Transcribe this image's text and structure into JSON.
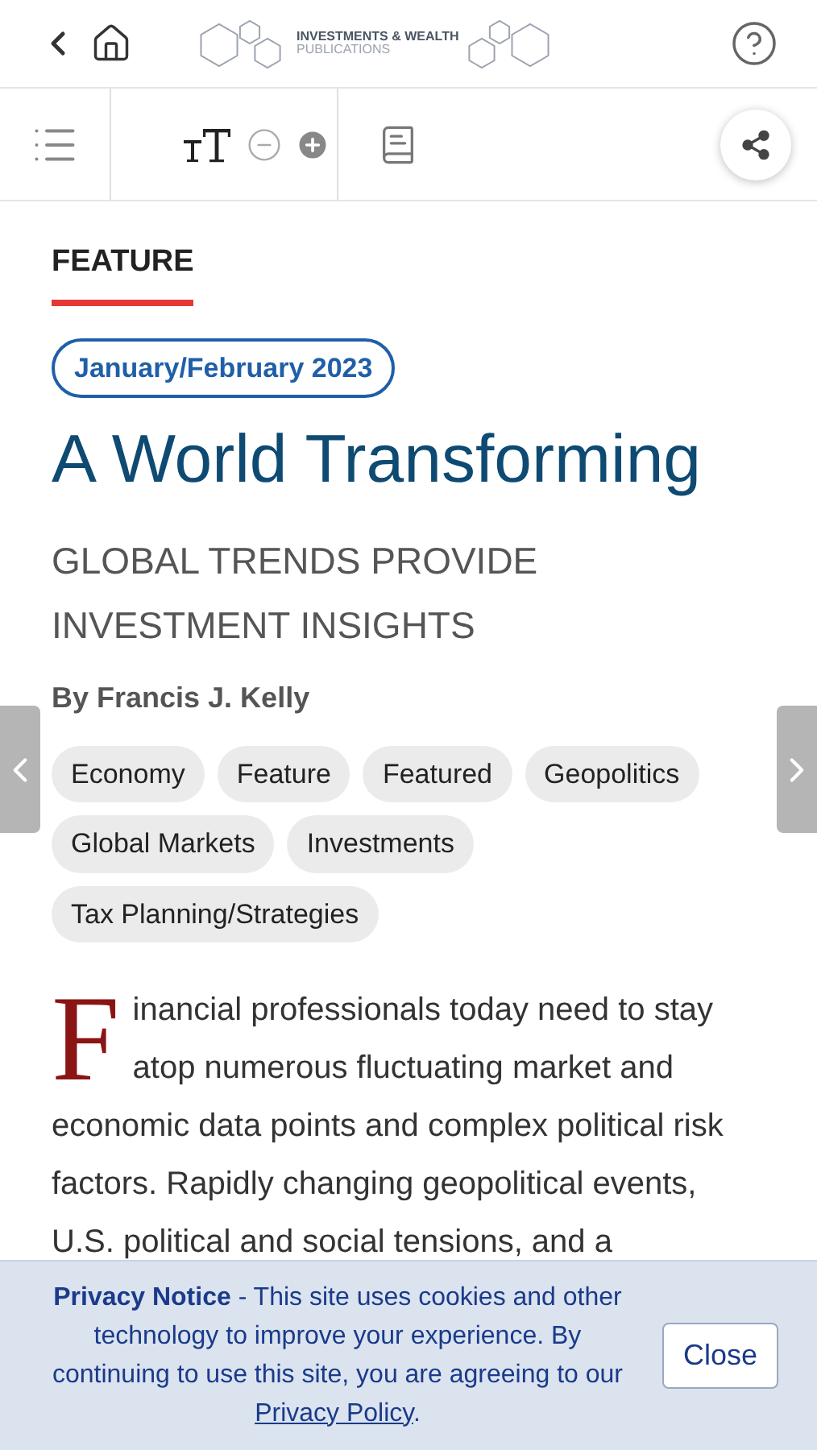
{
  "header": {
    "logo_line_1": "INVESTMENTS & WEALTH",
    "logo_line_2": "PUBLICATIONS"
  },
  "article": {
    "section": "FEATURE",
    "issue": "January/February 2023",
    "title": "A World Transforming",
    "subtitle": "GLOBAL TRENDS PROVIDE INVESTMENT INSIGHTS",
    "byline": "By Francis J. Kelly",
    "tags": [
      "Economy",
      "Feature",
      "Featured",
      "Geopolitics",
      "Global Markets",
      "Investments",
      "Tax Planning/Strategies"
    ],
    "drop_cap": "F",
    "body": "inancial professionals today need to stay atop numerous fluctuating market and economic data points and complex political risk factors. Rapidly changing geopolitical events, U.S. political and social tensions, and a"
  },
  "privacy": {
    "text": "**Privacy Notice** - This site uses cookies and other technology to improve your experience. By continuing to use this site, you are agreeing to our ",
    "link": "Privacy Policy",
    "after": ".",
    "button": "Close"
  }
}
